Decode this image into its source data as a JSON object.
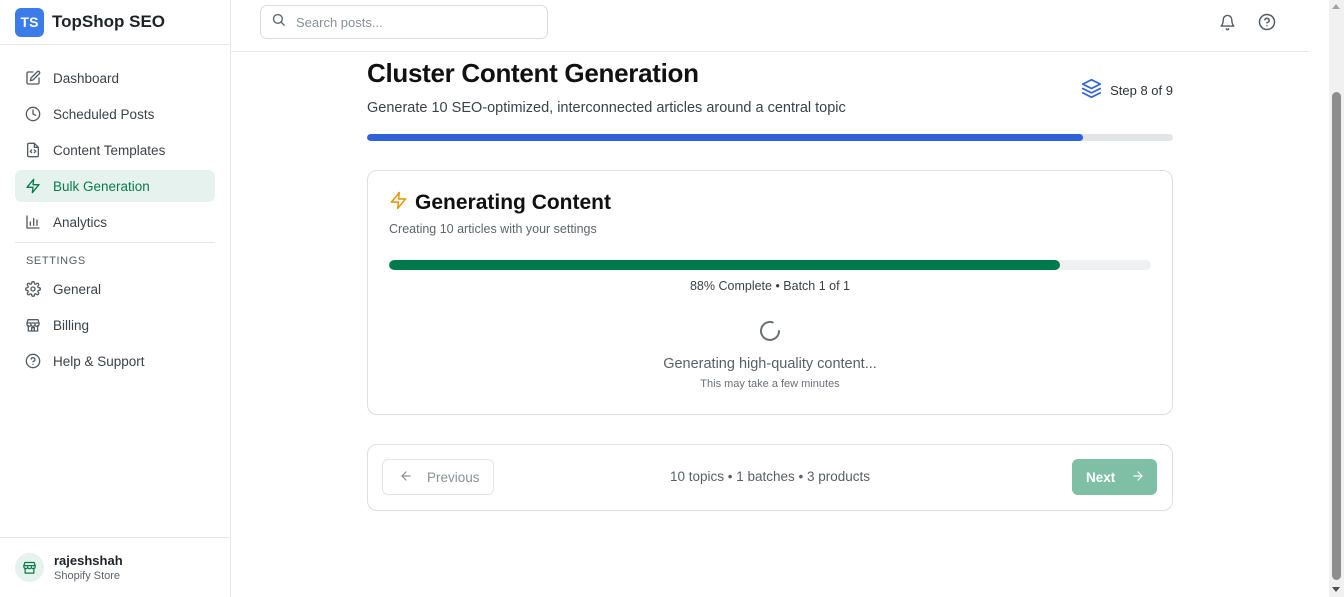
{
  "brand": {
    "logo_text": "TS",
    "name": "TopShop SEO",
    "color": "#3b7bea"
  },
  "sidebar": {
    "items": [
      {
        "label": "Dashboard",
        "icon": "edit-icon"
      },
      {
        "label": "Scheduled Posts",
        "icon": "clock-icon"
      },
      {
        "label": "Content Templates",
        "icon": "file-code-icon"
      },
      {
        "label": "Bulk Generation",
        "icon": "zap-icon",
        "active": true
      },
      {
        "label": "Analytics",
        "icon": "bar-chart-icon"
      }
    ],
    "settings_heading": "SETTINGS",
    "settings_items": [
      {
        "label": "General",
        "icon": "gear-icon"
      },
      {
        "label": "Billing",
        "icon": "store-icon"
      },
      {
        "label": "Help & Support",
        "icon": "help-circle-icon"
      }
    ],
    "active_color": "#0b7a4b"
  },
  "user": {
    "name": "rajeshshah",
    "role": "Shopify Store",
    "icon": "store-icon"
  },
  "topbar": {
    "search_placeholder": "Search posts...",
    "icons": [
      "bell-icon",
      "help-circle-icon"
    ]
  },
  "page": {
    "title": "Cluster Content Generation",
    "subtitle": "Generate 10 SEO-optimized, interconnected articles around a central topic",
    "step_label": "Step 8 of 9",
    "step_icon": "layers-icon",
    "progress_fraction": 0.888,
    "progress_color": "#2f62d9"
  },
  "generation": {
    "title": "Generating Content",
    "icon": "zap-icon",
    "subtitle": "Creating 10 articles with your settings",
    "progress_percent": 88,
    "progress_color": "#007a4d",
    "status": "88% Complete • Batch 1 of 1",
    "message": "Generating high-quality content...",
    "note": "This may take a few minutes"
  },
  "footer": {
    "previous_label": "Previous",
    "summary": "10 topics • 1 batches  • 3 products",
    "next_label": "Next",
    "next_color": "#7fbfa5"
  }
}
